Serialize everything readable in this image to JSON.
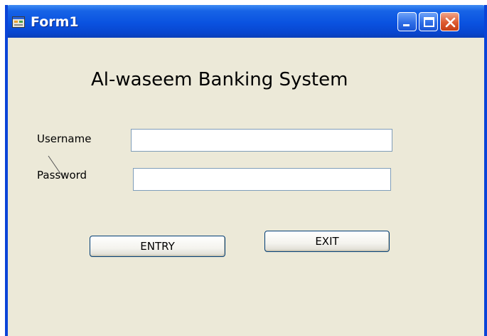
{
  "window": {
    "title": "Form1",
    "colors": {
      "titlebar": "#0a52e0",
      "border": "#0a44d8",
      "client_background": "#ece9d8",
      "close_button": "#dd5a30"
    },
    "controls": {
      "minimize_icon": "minimize-icon",
      "maximize_icon": "maximize-icon",
      "close_icon": "close-icon"
    }
  },
  "form": {
    "heading": "Al-waseem Banking System",
    "username_label": "Username",
    "username_value": "",
    "password_label": "Password",
    "password_value": "",
    "entry_button": "ENTRY",
    "exit_button": "EXIT"
  }
}
